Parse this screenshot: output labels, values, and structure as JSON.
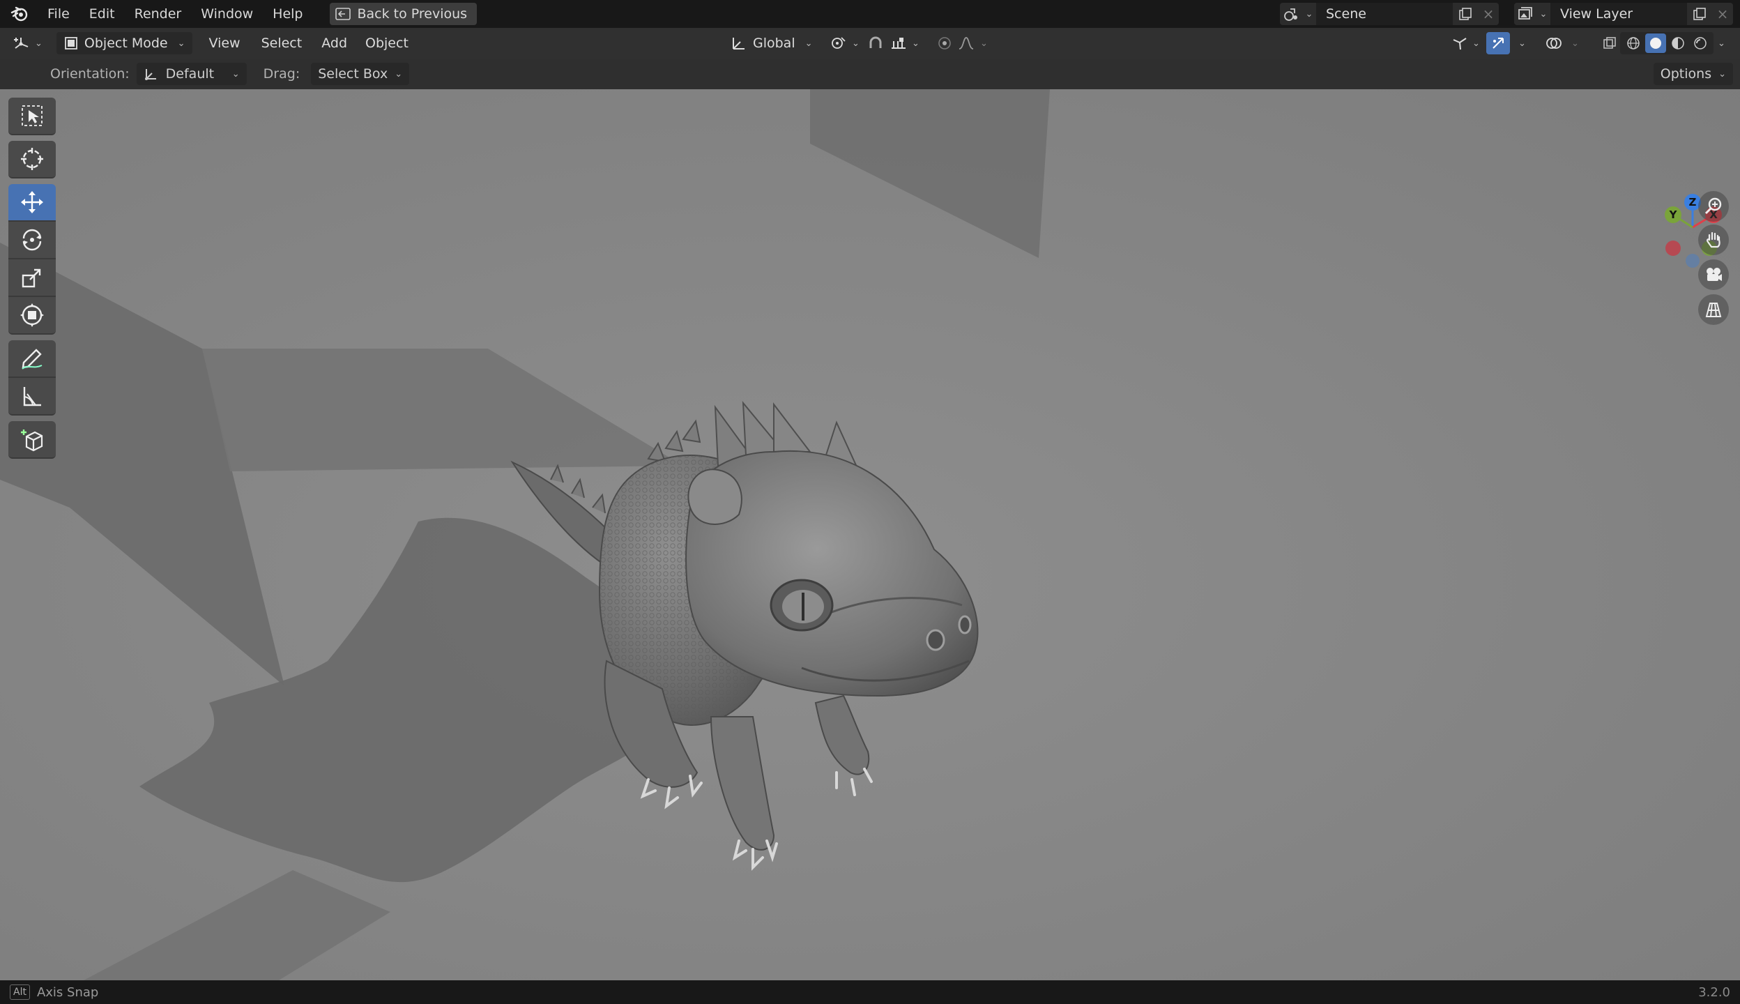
{
  "menu": {
    "items": [
      "File",
      "Edit",
      "Render",
      "Window",
      "Help"
    ],
    "back_button": "Back to Previous"
  },
  "scene": {
    "label": "Scene"
  },
  "view_layer": {
    "label": "View Layer"
  },
  "header": {
    "mode": "Object Mode",
    "menus": [
      "View",
      "Select",
      "Add",
      "Object"
    ],
    "transform_orientation": "Global"
  },
  "tool_settings": {
    "orientation_label": "Orientation:",
    "orientation_value": "Default",
    "drag_label": "Drag:",
    "drag_value": "Select Box",
    "options": "Options"
  },
  "gizmo": {
    "z": "Z",
    "y": "Y",
    "x": "X",
    "colors": {
      "x": "#e0404a",
      "y": "#7aa43a",
      "z": "#3a7fe0"
    }
  },
  "status": {
    "key": "Alt",
    "hint": "Axis Snap",
    "version": "3.2.0"
  },
  "theme": {
    "accent": "#4772b3"
  }
}
